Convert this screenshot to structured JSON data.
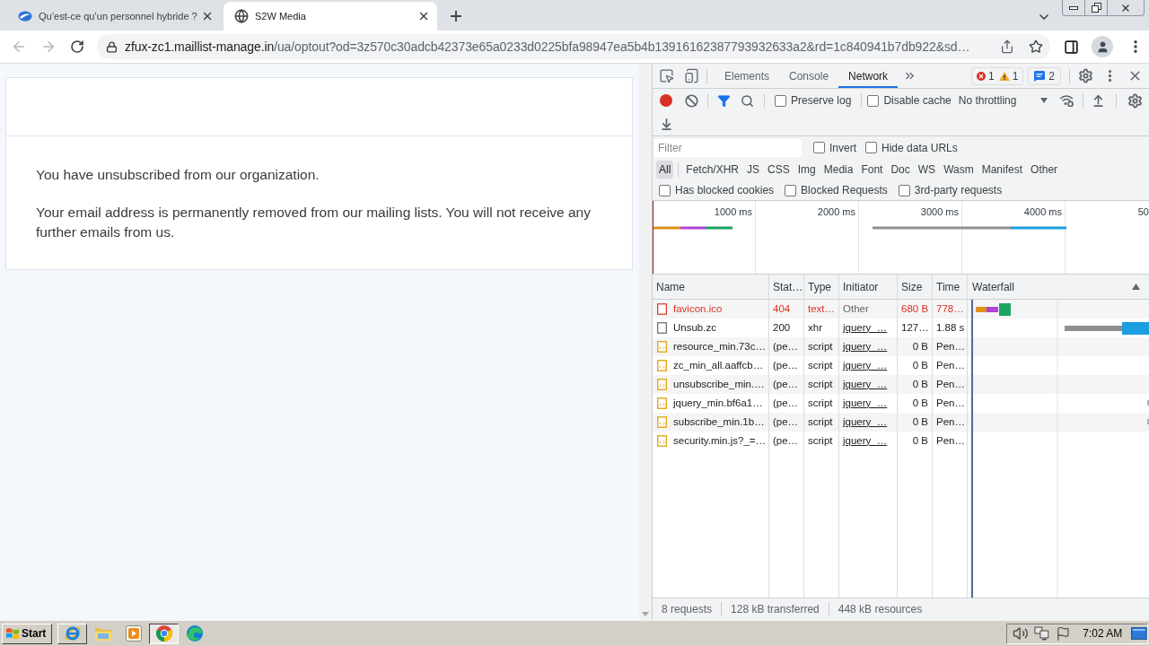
{
  "browser": {
    "tabs": [
      {
        "kind": "logo",
        "title": "Qu’est-ce qu’un personnel hybride ?",
        "selected": false
      },
      {
        "kind": "globe",
        "title": "S2W Media",
        "selected": true
      }
    ],
    "address_bar": {
      "host": "zfux-zc1.maillist-manage.in",
      "path": "/ua/optout?od=3z570c30adcb42373e65a0233d0225bfa98947ea5b4b13916162387793932633a2&rd=1c840941b7db922&sd…"
    }
  },
  "page": {
    "paragraphs": [
      "You have unsubscribed from our organization.",
      "Your email address is permanently removed from our mailing lists. You will not receive any further emails from us."
    ]
  },
  "devtools": {
    "tabs": [
      {
        "label": "Elements",
        "selected": false
      },
      {
        "label": "Console",
        "selected": false
      },
      {
        "label": "Network",
        "selected": true
      }
    ],
    "issue_counts": {
      "errors": "1",
      "warnings": "1",
      "messages": "2"
    },
    "toolbar": {
      "recording": true,
      "options": [
        {
          "label": "Preserve log",
          "checked": false
        },
        {
          "label": "Disable cache",
          "checked": false
        }
      ],
      "throttling": "No throttling"
    },
    "filter": {
      "placeholder": "Filter",
      "options": [
        {
          "label": "Invert",
          "checked": false
        },
        {
          "label": "Hide data URLs",
          "checked": false
        }
      ]
    },
    "resource_types": [
      {
        "label": "All",
        "selected": true
      },
      {
        "label": "Fetch/XHR",
        "selected": false
      },
      {
        "label": "JS",
        "selected": false
      },
      {
        "label": "CSS",
        "selected": false
      },
      {
        "label": "Img",
        "selected": false
      },
      {
        "label": "Media",
        "selected": false
      },
      {
        "label": "Font",
        "selected": false
      },
      {
        "label": "Doc",
        "selected": false
      },
      {
        "label": "WS",
        "selected": false
      },
      {
        "label": "Wasm",
        "selected": false
      },
      {
        "label": "Manifest",
        "selected": false
      },
      {
        "label": "Other",
        "selected": false
      }
    ],
    "request_filters": [
      {
        "label": "Has blocked cookies",
        "checked": false
      },
      {
        "label": "Blocked Requests",
        "checked": false
      },
      {
        "label": "3rd-party requests",
        "checked": false
      }
    ],
    "overview": {
      "ticks": [
        "1000 ms",
        "2000 ms",
        "3000 ms",
        "4000 ms",
        "50"
      ]
    },
    "table": {
      "columns": [
        "Name",
        "Stat…",
        "Type",
        "Initiator",
        "Size",
        "Time",
        "Waterfall"
      ],
      "rows": [
        {
          "kind": "plain",
          "name": "favicon.ico",
          "status": "404",
          "type": "text…",
          "initiator": "Other",
          "initiator_link": false,
          "size": "680 B",
          "time": "778…",
          "failed": true
        },
        {
          "kind": "plain",
          "name": "Unsub.zc",
          "status": "200",
          "type": "xhr",
          "initiator": "jquery_…",
          "initiator_link": true,
          "size": "127…",
          "time": "1.88 s",
          "failed": false
        },
        {
          "kind": "script",
          "name": "resource_min.73c…",
          "status": "(pe…",
          "type": "script",
          "initiator": "jquery_…",
          "initiator_link": true,
          "size": "0 B",
          "time": "Pen…",
          "failed": false
        },
        {
          "kind": "script",
          "name": "zc_min_all.aaffcb…",
          "status": "(pe…",
          "type": "script",
          "initiator": "jquery_…",
          "initiator_link": true,
          "size": "0 B",
          "time": "Pen…",
          "failed": false
        },
        {
          "kind": "script",
          "name": "unsubscribe_min.…",
          "status": "(pe…",
          "type": "script",
          "initiator": "jquery_…",
          "initiator_link": true,
          "size": "0 B",
          "time": "Pen…",
          "failed": false
        },
        {
          "kind": "script",
          "name": "jquery_min.bf6a1…",
          "status": "(pe…",
          "type": "script",
          "initiator": "jquery_…",
          "initiator_link": true,
          "size": "0 B",
          "time": "Pen…",
          "failed": false
        },
        {
          "kind": "script",
          "name": "subscribe_min.1b…",
          "status": "(pe…",
          "type": "script",
          "initiator": "jquery_…",
          "initiator_link": true,
          "size": "0 B",
          "time": "Pen…",
          "failed": false
        },
        {
          "kind": "script",
          "name": "security.min.js?_=…",
          "status": "(pe…",
          "type": "script",
          "initiator": "jquery_…",
          "initiator_link": true,
          "size": "0 B",
          "time": "Pen…",
          "failed": false
        }
      ]
    },
    "summary": [
      "8 requests",
      "128 kB transferred",
      "448 kB resources"
    ]
  },
  "taskbar": {
    "start": "Start",
    "apps": [
      {
        "kind": "ie",
        "running": true,
        "selected": false
      },
      {
        "kind": "folder",
        "running": false,
        "selected": false
      },
      {
        "kind": "media",
        "running": false,
        "selected": false
      },
      {
        "kind": "chrome",
        "running": true,
        "selected": true
      },
      {
        "kind": "edge",
        "running": false,
        "selected": false
      }
    ],
    "clock": "7:02 AM"
  }
}
